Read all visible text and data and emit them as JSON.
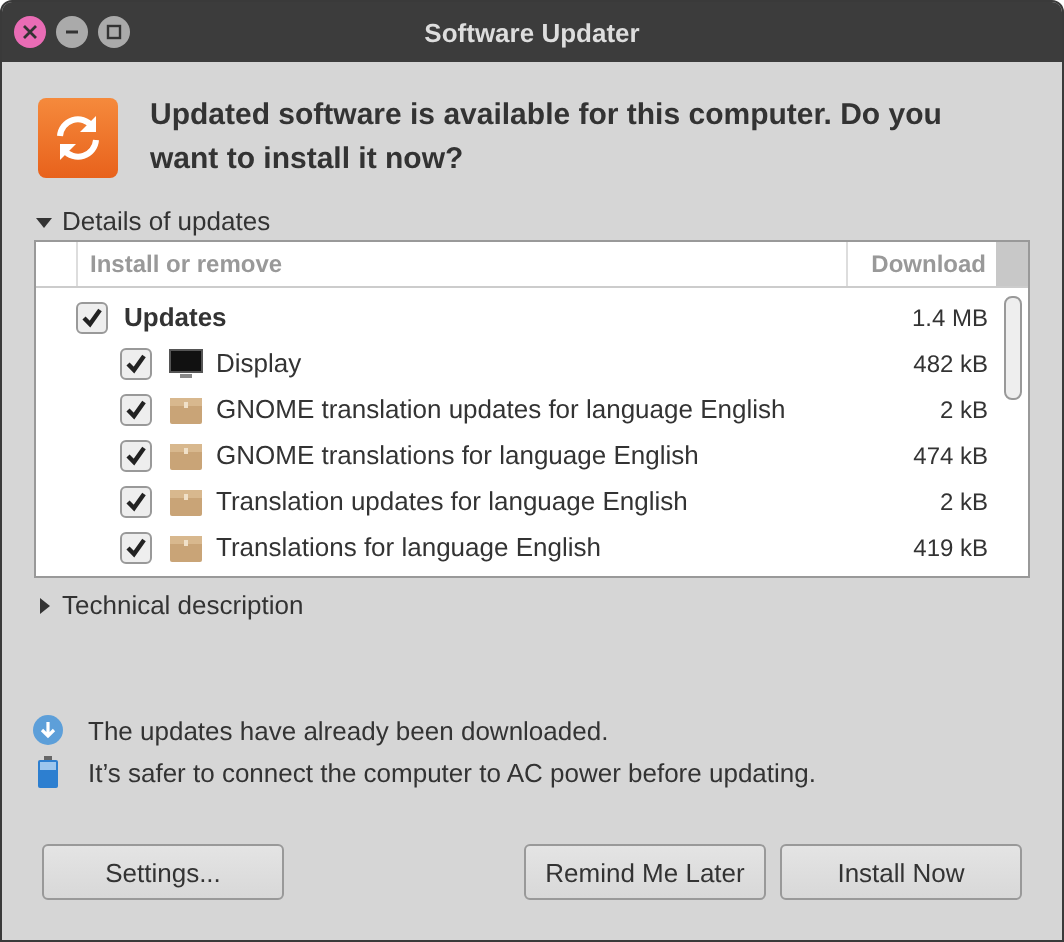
{
  "window": {
    "title": "Software Updater"
  },
  "headline": "Updated software is available for this computer. Do you want to install it now?",
  "details": {
    "label": "Details of updates",
    "expanded": true,
    "columns": [
      "Install or remove",
      "Download"
    ],
    "groups": [
      {
        "name": "Updates",
        "checked": true,
        "size": "1.4 MB",
        "children": [
          {
            "name": "Display",
            "kind": "display",
            "checked": true,
            "size": "482 kB"
          },
          {
            "name": "GNOME translation updates for language English",
            "kind": "package",
            "checked": true,
            "size": "2 kB"
          },
          {
            "name": "GNOME translations for language English",
            "kind": "package",
            "checked": true,
            "size": "474 kB"
          },
          {
            "name": "Translation updates for language English",
            "kind": "package",
            "checked": true,
            "size": "2 kB"
          },
          {
            "name": "Translations for language English",
            "kind": "package",
            "checked": true,
            "size": "419 kB"
          }
        ]
      }
    ]
  },
  "technical": {
    "label": "Technical description",
    "expanded": false
  },
  "notices": [
    {
      "kind": "download",
      "text": "The updates have already been downloaded."
    },
    {
      "kind": "battery",
      "text": "It’s safer to connect the computer to AC power before updating."
    }
  ],
  "buttons": {
    "left": [
      "Settings..."
    ],
    "right": [
      "Remind Me Later",
      "Install Now"
    ]
  }
}
